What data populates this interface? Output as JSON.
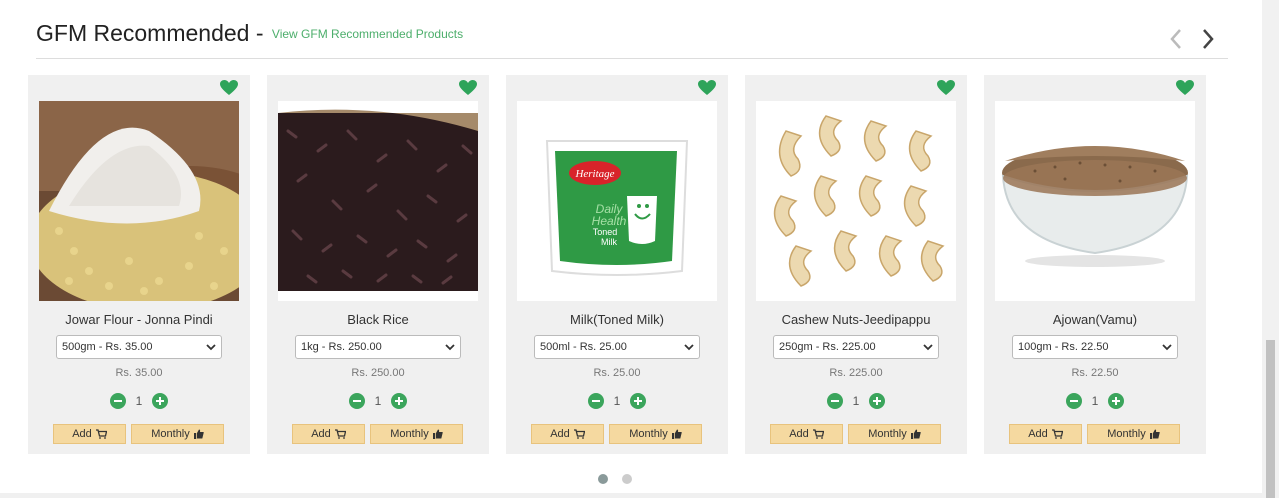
{
  "header": {
    "title": "GFM Recommended - ",
    "link": "View GFM Recommended Products"
  },
  "colors": {
    "accent": "#4cae6b",
    "button_bg": "#f5d9a0",
    "card_bg": "#f0f0f0"
  },
  "products": [
    {
      "name": "Jowar Flour - Jonna Pindi",
      "variant": "500gm - Rs. 35.00",
      "price": "Rs. 35.00",
      "qty": "1",
      "add": "Add",
      "monthly": "Monthly"
    },
    {
      "name": "Black Rice",
      "variant": "1kg - Rs. 250.00",
      "price": "Rs. 250.00",
      "qty": "1",
      "add": "Add",
      "monthly": "Monthly"
    },
    {
      "name": "Milk(Toned Milk)",
      "variant": "500ml - Rs. 25.00",
      "price": "Rs. 25.00",
      "qty": "1",
      "add": "Add",
      "monthly": "Monthly"
    },
    {
      "name": "Cashew Nuts-Jeedipappu",
      "variant": "250gm - Rs. 225.00",
      "price": "Rs. 225.00",
      "qty": "1",
      "add": "Add",
      "monthly": "Monthly"
    },
    {
      "name": "Ajowan(Vamu)",
      "variant": "100gm - Rs. 22.50",
      "price": "Rs. 22.50",
      "qty": "1",
      "add": "Add",
      "monthly": "Monthly"
    }
  ],
  "milk_pack": {
    "brand": "Heritage",
    "line1": "Daily",
    "line2": "Health",
    "line3": "Toned",
    "line4": "Milk"
  },
  "carousel": {
    "pages": 2,
    "active": 1
  }
}
